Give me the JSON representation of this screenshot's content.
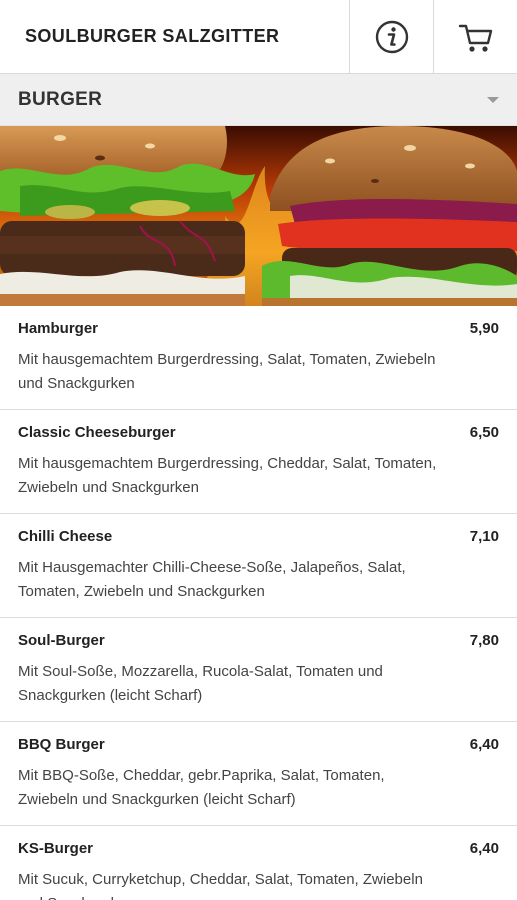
{
  "header": {
    "title": "SOULBURGER SALZGITTER",
    "info_icon": "info-icon",
    "cart_icon": "cart-icon"
  },
  "category": {
    "selected": "BURGER"
  },
  "banner": {
    "image": "burger-banner-image"
  },
  "menu": {
    "items": [
      {
        "name": "Hamburger",
        "price": "5,90",
        "description": "Mit hausgemachtem Burgerdressing, Salat, Tomaten, Zwiebeln und Snackgurken"
      },
      {
        "name": "Classic Cheeseburger",
        "price": "6,50",
        "description": "Mit hausgemachtem Burgerdressing, Cheddar, Salat, Tomaten, Zwiebeln und Snackgurken"
      },
      {
        "name": "Chilli Cheese",
        "price": "7,10",
        "description": "Mit Hausgemachter Chilli-Cheese-Soße, Jalapeños, Salat, Tomaten, Zwiebeln und Snackgurken"
      },
      {
        "name": "Soul-Burger",
        "price": "7,80",
        "description": "Mit Soul-Soße, Mozzarella, Rucola-Salat, Tomaten und Snackgurken (leicht Scharf)"
      },
      {
        "name": "BBQ Burger",
        "price": "6,40",
        "description": "Mit BBQ-Soße, Cheddar, gebr.Paprika, Salat, Tomaten, Zwiebeln und Snackgurken (leicht Scharf)"
      },
      {
        "name": "KS-Burger",
        "price": "6,40",
        "description": "Mit Sucuk, Curryketchup, Cheddar, Salat, Tomaten, Zwiebeln und Snackgurken"
      }
    ]
  }
}
